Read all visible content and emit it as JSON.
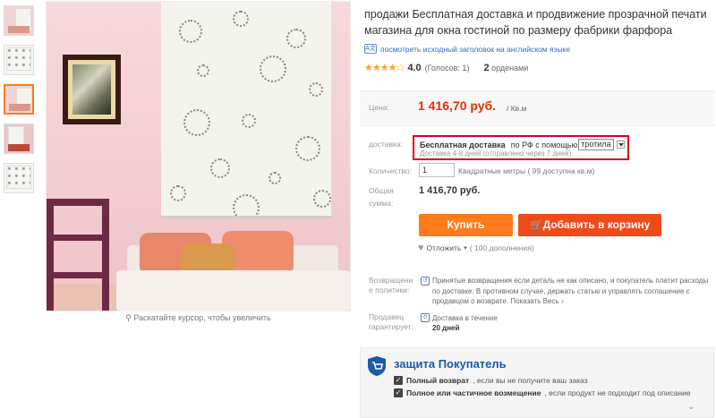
{
  "product": {
    "title": "продажи Бесплатная доставка и продвижение прозрачной печати магазина для окна гостиной по размеру фабрики фарфора",
    "original_title_link": "посмотреть исходный заголовок на английском языке",
    "rating_score": "4.0",
    "votes": "(Голосов: 1)",
    "orders_count": "2",
    "orders_label": "орденами",
    "zoom_hint": "Раскатайте курсор, чтобы увеличить",
    "image_count": 5,
    "active_thumb": 3
  },
  "price": {
    "label": "Цена:",
    "value": "1 416,70 руб.",
    "unit": "/ Кв.м"
  },
  "shipping": {
    "label": "доставка:",
    "free": "Бесплатная доставка",
    "via": "по РФ с помощью",
    "method": "тротила",
    "eta": "Доставка 4-8 дней (отправлено через 7 дней)"
  },
  "quantity": {
    "label": "Количество:",
    "value": "1",
    "note": "Квадратные метры ( 99 доступна кв.м)"
  },
  "total": {
    "label_line1": "Общая",
    "label_line2": "сумма:",
    "value": "1 416,70 руб."
  },
  "actions": {
    "buy": "Купить",
    "cart": "Добавить в корзину",
    "wishlist": "Отложить",
    "wishlist_count": "( 100 дополнения)"
  },
  "returns": {
    "label_line1": "Возвращени",
    "label_line2": "е политики:",
    "text": "Принятые возвращения если деталь не как описано, и покупатель платит расходы по доставке. В противном случае, держать статью и управлять соглашение с продавцом о возврате. Показать Весь"
  },
  "guarantee": {
    "label_line1": "Продавец",
    "label_line2": "гарантирует:",
    "text": "Доставка в течение",
    "days": "20 дней"
  },
  "protection": {
    "title": "защита Покупатель",
    "row1_bold": "Полный возврат",
    "row1_rest": ", если вы не получите ваш заказ",
    "row2_bold": "Полное или частичное возмещение",
    "row2_rest": ", если продукт не подходит под описание"
  },
  "colors": {
    "accent_orange": "#ff7b1c",
    "cart_red": "#f04a1a",
    "price_red": "#e62e04",
    "highlight_red": "#e0001b",
    "link_blue": "#2f6bbf"
  }
}
